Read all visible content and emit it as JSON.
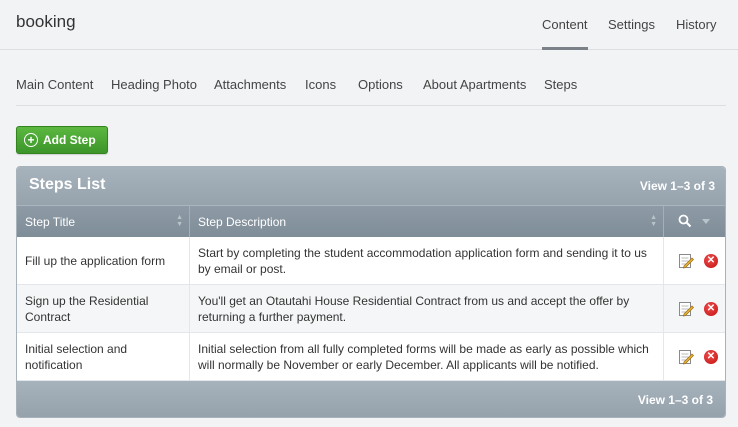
{
  "app": {
    "title": "booking"
  },
  "top_tabs": [
    {
      "label": "Content",
      "active": true
    },
    {
      "label": "Settings",
      "active": false
    },
    {
      "label": "History",
      "active": false
    }
  ],
  "sub_tabs": [
    {
      "label": "Main Content"
    },
    {
      "label": "Heading Photo"
    },
    {
      "label": "Attachments"
    },
    {
      "label": "Icons"
    },
    {
      "label": "Options"
    },
    {
      "label": "About Apartments"
    },
    {
      "label": "Steps",
      "active": true
    }
  ],
  "toolbar": {
    "add_label": "Add Step",
    "add_icon": "plus-circle-icon"
  },
  "list": {
    "title": "Steps List",
    "view_count": "View 1–3 of 3",
    "columns": [
      "Step Title",
      "Step Description"
    ],
    "rows": [
      {
        "title": "Fill up the application form",
        "description": "Start by completing the student accommodation application form and sending it to us by email or post."
      },
      {
        "title": "Sign up the Residential Contract",
        "description": "You'll get an Otautahi House Residential Contract from us and accept the offer by returning a further payment."
      },
      {
        "title": "Initial selection and notification",
        "description": "Initial selection from all fully completed forms will be made as early as possible which will normally be November or early December. All applicants will be notified."
      }
    ]
  },
  "colors": {
    "accent_green": "#4aa834",
    "panel_header": "#9eabb5",
    "delete_red": "#d42020"
  }
}
